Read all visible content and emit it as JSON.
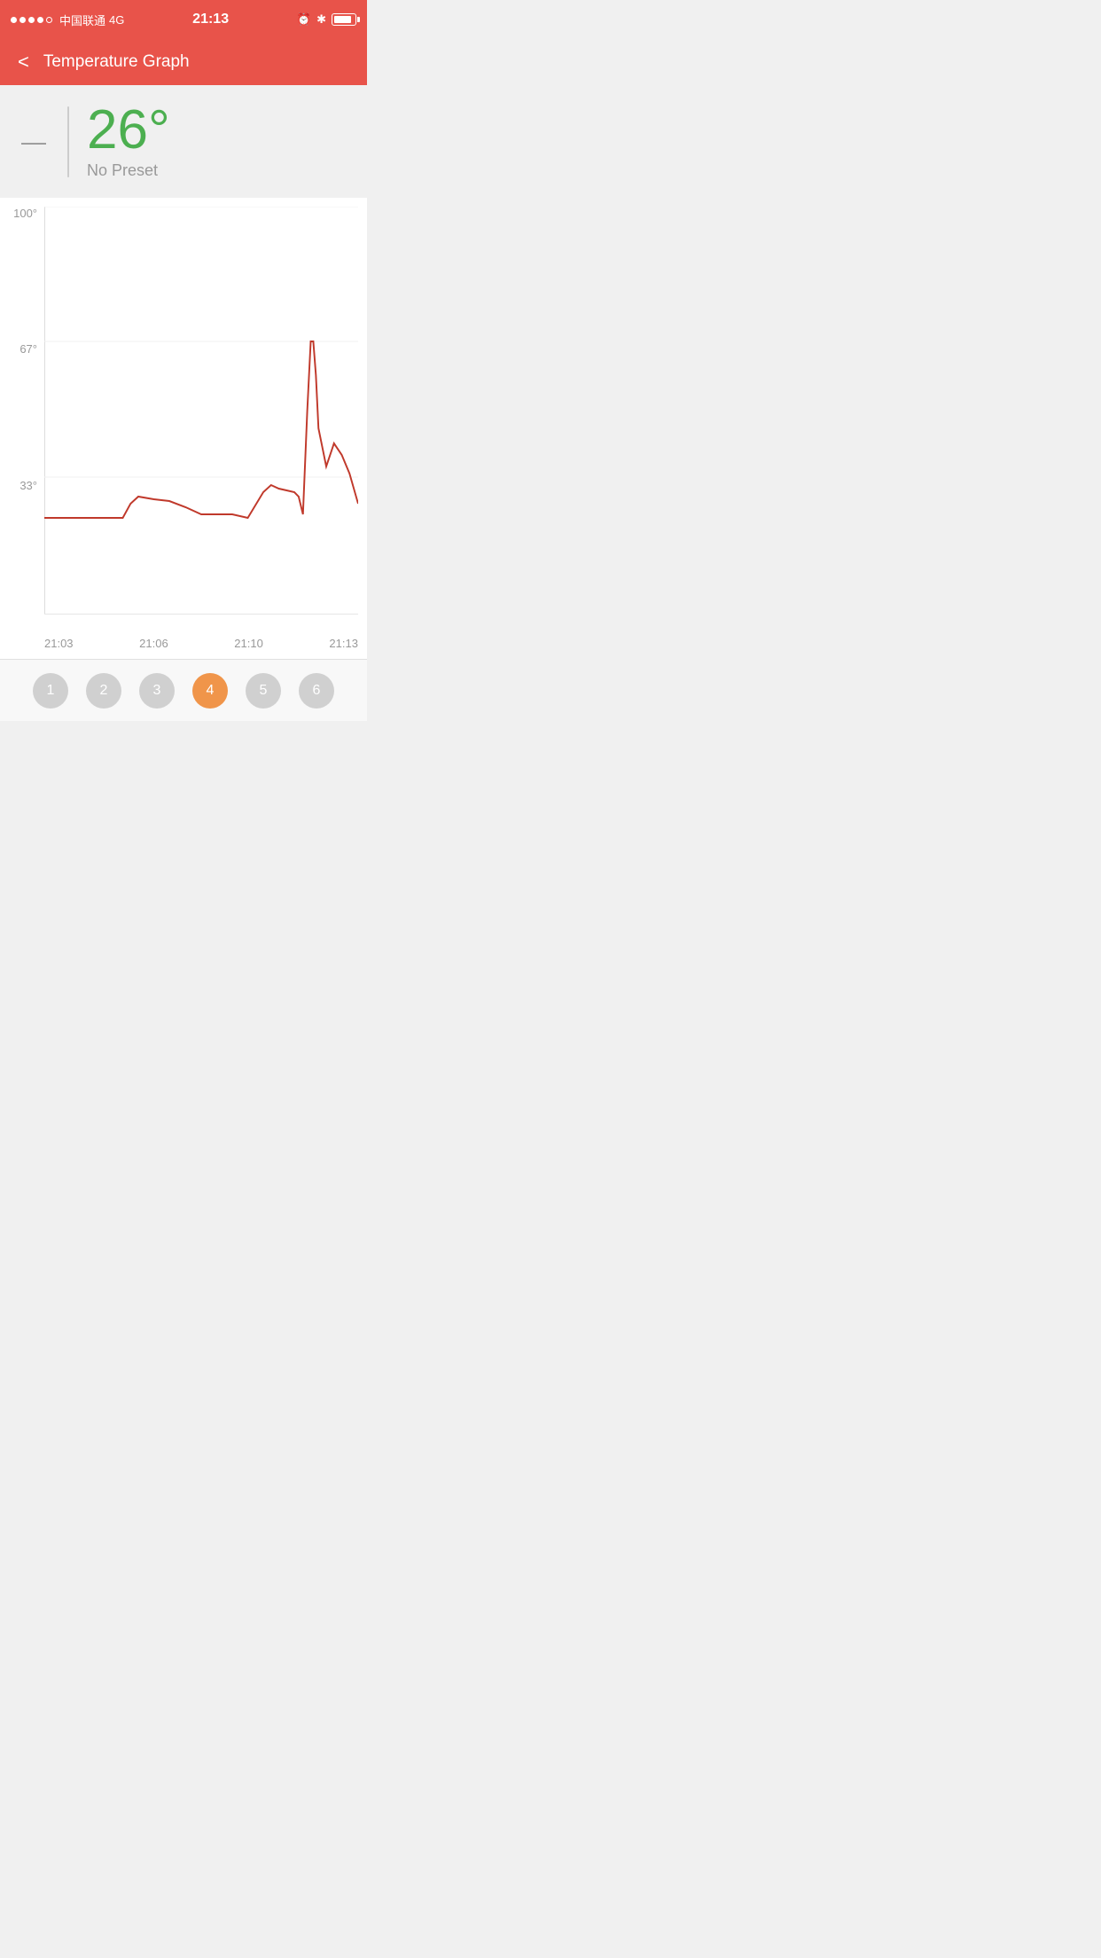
{
  "statusBar": {
    "carrier": "中国联通",
    "network": "4G",
    "time": "21:13"
  },
  "header": {
    "backLabel": "<",
    "title": "Temperature Graph"
  },
  "infoPanel": {
    "dash": "—",
    "temperature": "26°",
    "preset": "No Preset"
  },
  "chart": {
    "yLabels": [
      "100°",
      "67°",
      "33°"
    ],
    "xLabels": [
      "21:03",
      "21:06",
      "21:10",
      "21:13"
    ],
    "lineColor": "#c0392b",
    "gridColor": "#f0f0f0"
  },
  "tabs": [
    {
      "label": "1",
      "active": false
    },
    {
      "label": "2",
      "active": false
    },
    {
      "label": "3",
      "active": false
    },
    {
      "label": "4",
      "active": true
    },
    {
      "label": "5",
      "active": false
    },
    {
      "label": "6",
      "active": false
    }
  ]
}
